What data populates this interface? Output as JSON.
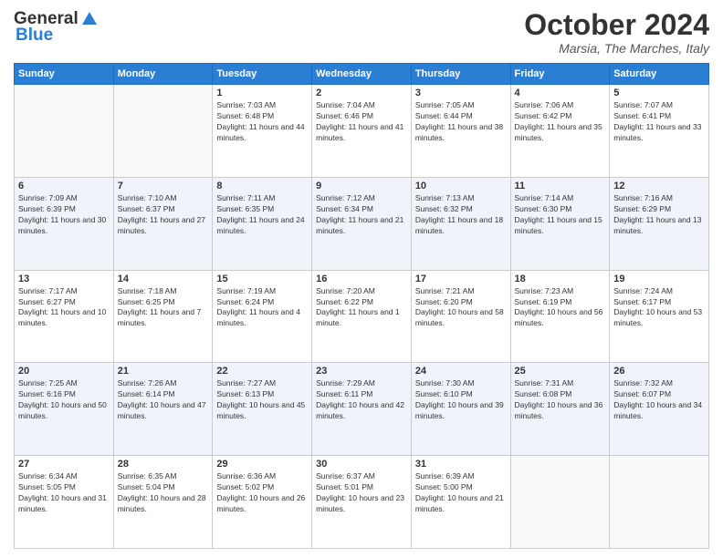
{
  "header": {
    "logo_line1": "General",
    "logo_line2": "Blue",
    "month_title": "October 2024",
    "location": "Marsia, The Marches, Italy"
  },
  "weekdays": [
    "Sunday",
    "Monday",
    "Tuesday",
    "Wednesday",
    "Thursday",
    "Friday",
    "Saturday"
  ],
  "weeks": [
    [
      {
        "day": "",
        "sunrise": "",
        "sunset": "",
        "daylight": ""
      },
      {
        "day": "",
        "sunrise": "",
        "sunset": "",
        "daylight": ""
      },
      {
        "day": "1",
        "sunrise": "Sunrise: 7:03 AM",
        "sunset": "Sunset: 6:48 PM",
        "daylight": "Daylight: 11 hours and 44 minutes."
      },
      {
        "day": "2",
        "sunrise": "Sunrise: 7:04 AM",
        "sunset": "Sunset: 6:46 PM",
        "daylight": "Daylight: 11 hours and 41 minutes."
      },
      {
        "day": "3",
        "sunrise": "Sunrise: 7:05 AM",
        "sunset": "Sunset: 6:44 PM",
        "daylight": "Daylight: 11 hours and 38 minutes."
      },
      {
        "day": "4",
        "sunrise": "Sunrise: 7:06 AM",
        "sunset": "Sunset: 6:42 PM",
        "daylight": "Daylight: 11 hours and 35 minutes."
      },
      {
        "day": "5",
        "sunrise": "Sunrise: 7:07 AM",
        "sunset": "Sunset: 6:41 PM",
        "daylight": "Daylight: 11 hours and 33 minutes."
      }
    ],
    [
      {
        "day": "6",
        "sunrise": "Sunrise: 7:09 AM",
        "sunset": "Sunset: 6:39 PM",
        "daylight": "Daylight: 11 hours and 30 minutes."
      },
      {
        "day": "7",
        "sunrise": "Sunrise: 7:10 AM",
        "sunset": "Sunset: 6:37 PM",
        "daylight": "Daylight: 11 hours and 27 minutes."
      },
      {
        "day": "8",
        "sunrise": "Sunrise: 7:11 AM",
        "sunset": "Sunset: 6:35 PM",
        "daylight": "Daylight: 11 hours and 24 minutes."
      },
      {
        "day": "9",
        "sunrise": "Sunrise: 7:12 AM",
        "sunset": "Sunset: 6:34 PM",
        "daylight": "Daylight: 11 hours and 21 minutes."
      },
      {
        "day": "10",
        "sunrise": "Sunrise: 7:13 AM",
        "sunset": "Sunset: 6:32 PM",
        "daylight": "Daylight: 11 hours and 18 minutes."
      },
      {
        "day": "11",
        "sunrise": "Sunrise: 7:14 AM",
        "sunset": "Sunset: 6:30 PM",
        "daylight": "Daylight: 11 hours and 15 minutes."
      },
      {
        "day": "12",
        "sunrise": "Sunrise: 7:16 AM",
        "sunset": "Sunset: 6:29 PM",
        "daylight": "Daylight: 11 hours and 13 minutes."
      }
    ],
    [
      {
        "day": "13",
        "sunrise": "Sunrise: 7:17 AM",
        "sunset": "Sunset: 6:27 PM",
        "daylight": "Daylight: 11 hours and 10 minutes."
      },
      {
        "day": "14",
        "sunrise": "Sunrise: 7:18 AM",
        "sunset": "Sunset: 6:25 PM",
        "daylight": "Daylight: 11 hours and 7 minutes."
      },
      {
        "day": "15",
        "sunrise": "Sunrise: 7:19 AM",
        "sunset": "Sunset: 6:24 PM",
        "daylight": "Daylight: 11 hours and 4 minutes."
      },
      {
        "day": "16",
        "sunrise": "Sunrise: 7:20 AM",
        "sunset": "Sunset: 6:22 PM",
        "daylight": "Daylight: 11 hours and 1 minute."
      },
      {
        "day": "17",
        "sunrise": "Sunrise: 7:21 AM",
        "sunset": "Sunset: 6:20 PM",
        "daylight": "Daylight: 10 hours and 58 minutes."
      },
      {
        "day": "18",
        "sunrise": "Sunrise: 7:23 AM",
        "sunset": "Sunset: 6:19 PM",
        "daylight": "Daylight: 10 hours and 56 minutes."
      },
      {
        "day": "19",
        "sunrise": "Sunrise: 7:24 AM",
        "sunset": "Sunset: 6:17 PM",
        "daylight": "Daylight: 10 hours and 53 minutes."
      }
    ],
    [
      {
        "day": "20",
        "sunrise": "Sunrise: 7:25 AM",
        "sunset": "Sunset: 6:16 PM",
        "daylight": "Daylight: 10 hours and 50 minutes."
      },
      {
        "day": "21",
        "sunrise": "Sunrise: 7:26 AM",
        "sunset": "Sunset: 6:14 PM",
        "daylight": "Daylight: 10 hours and 47 minutes."
      },
      {
        "day": "22",
        "sunrise": "Sunrise: 7:27 AM",
        "sunset": "Sunset: 6:13 PM",
        "daylight": "Daylight: 10 hours and 45 minutes."
      },
      {
        "day": "23",
        "sunrise": "Sunrise: 7:29 AM",
        "sunset": "Sunset: 6:11 PM",
        "daylight": "Daylight: 10 hours and 42 minutes."
      },
      {
        "day": "24",
        "sunrise": "Sunrise: 7:30 AM",
        "sunset": "Sunset: 6:10 PM",
        "daylight": "Daylight: 10 hours and 39 minutes."
      },
      {
        "day": "25",
        "sunrise": "Sunrise: 7:31 AM",
        "sunset": "Sunset: 6:08 PM",
        "daylight": "Daylight: 10 hours and 36 minutes."
      },
      {
        "day": "26",
        "sunrise": "Sunrise: 7:32 AM",
        "sunset": "Sunset: 6:07 PM",
        "daylight": "Daylight: 10 hours and 34 minutes."
      }
    ],
    [
      {
        "day": "27",
        "sunrise": "Sunrise: 6:34 AM",
        "sunset": "Sunset: 5:05 PM",
        "daylight": "Daylight: 10 hours and 31 minutes."
      },
      {
        "day": "28",
        "sunrise": "Sunrise: 6:35 AM",
        "sunset": "Sunset: 5:04 PM",
        "daylight": "Daylight: 10 hours and 28 minutes."
      },
      {
        "day": "29",
        "sunrise": "Sunrise: 6:36 AM",
        "sunset": "Sunset: 5:02 PM",
        "daylight": "Daylight: 10 hours and 26 minutes."
      },
      {
        "day": "30",
        "sunrise": "Sunrise: 6:37 AM",
        "sunset": "Sunset: 5:01 PM",
        "daylight": "Daylight: 10 hours and 23 minutes."
      },
      {
        "day": "31",
        "sunrise": "Sunrise: 6:39 AM",
        "sunset": "Sunset: 5:00 PM",
        "daylight": "Daylight: 10 hours and 21 minutes."
      },
      {
        "day": "",
        "sunrise": "",
        "sunset": "",
        "daylight": ""
      },
      {
        "day": "",
        "sunrise": "",
        "sunset": "",
        "daylight": ""
      }
    ]
  ]
}
